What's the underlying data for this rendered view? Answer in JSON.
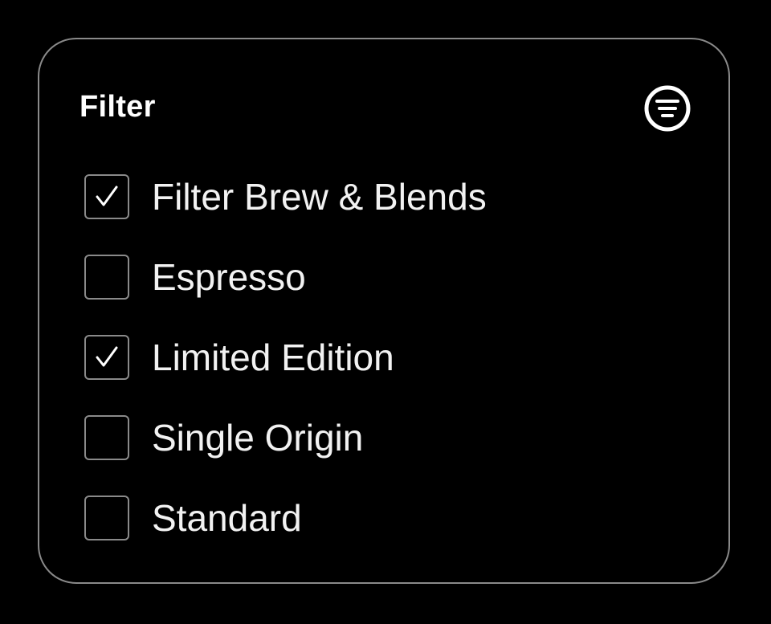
{
  "filter_panel": {
    "title": "Filter",
    "menu_icon": "filter-lines-icon",
    "options": [
      {
        "label": "Filter Brew & Blends",
        "checked": true
      },
      {
        "label": "Espresso",
        "checked": false
      },
      {
        "label": "Limited Edition",
        "checked": true
      },
      {
        "label": "Single Origin",
        "checked": false
      },
      {
        "label": "Standard",
        "checked": false
      }
    ]
  },
  "colors": {
    "background": "#000000",
    "border": "#8a8a8a",
    "text": "#f2f2f2"
  }
}
